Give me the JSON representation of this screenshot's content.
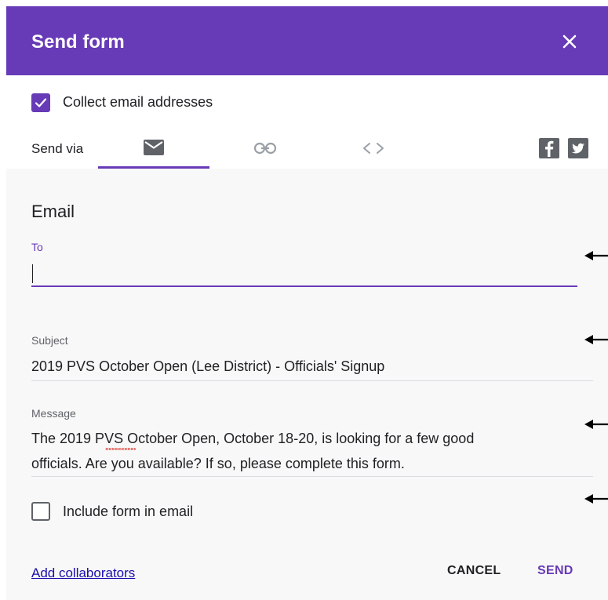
{
  "dialog": {
    "title": "Send form",
    "close_icon": "close-icon"
  },
  "collect": {
    "label": "Collect email addresses",
    "checked": true
  },
  "send_via": {
    "label": "Send via",
    "tabs": [
      {
        "name": "email",
        "icon": "email-icon",
        "selected": true
      },
      {
        "name": "link",
        "icon": "link-icon",
        "selected": false
      },
      {
        "name": "embed",
        "icon": "embed-icon",
        "selected": false
      }
    ],
    "social": [
      {
        "name": "facebook",
        "icon": "facebook-icon"
      },
      {
        "name": "twitter",
        "icon": "twitter-icon"
      }
    ]
  },
  "email": {
    "section_title": "Email",
    "to": {
      "label": "To",
      "value": ""
    },
    "subject": {
      "label": "Subject",
      "value": "2019 PVS October Open (Lee District) - Officials' Signup"
    },
    "message": {
      "label": "Message",
      "line1": "The 2019 PVS October Open, October 18-20, is looking for a few good",
      "line2": "officials.  Are you available?  If so, please complete this form."
    },
    "include_form": {
      "label": "Include form in email",
      "checked": false
    }
  },
  "footer": {
    "add_collaborators": "Add collaborators",
    "cancel": "CANCEL",
    "send": "SEND"
  },
  "colors": {
    "accent": "#673ab7",
    "link": "#1a0dab",
    "text": "#202124",
    "muted": "#5f6368"
  }
}
